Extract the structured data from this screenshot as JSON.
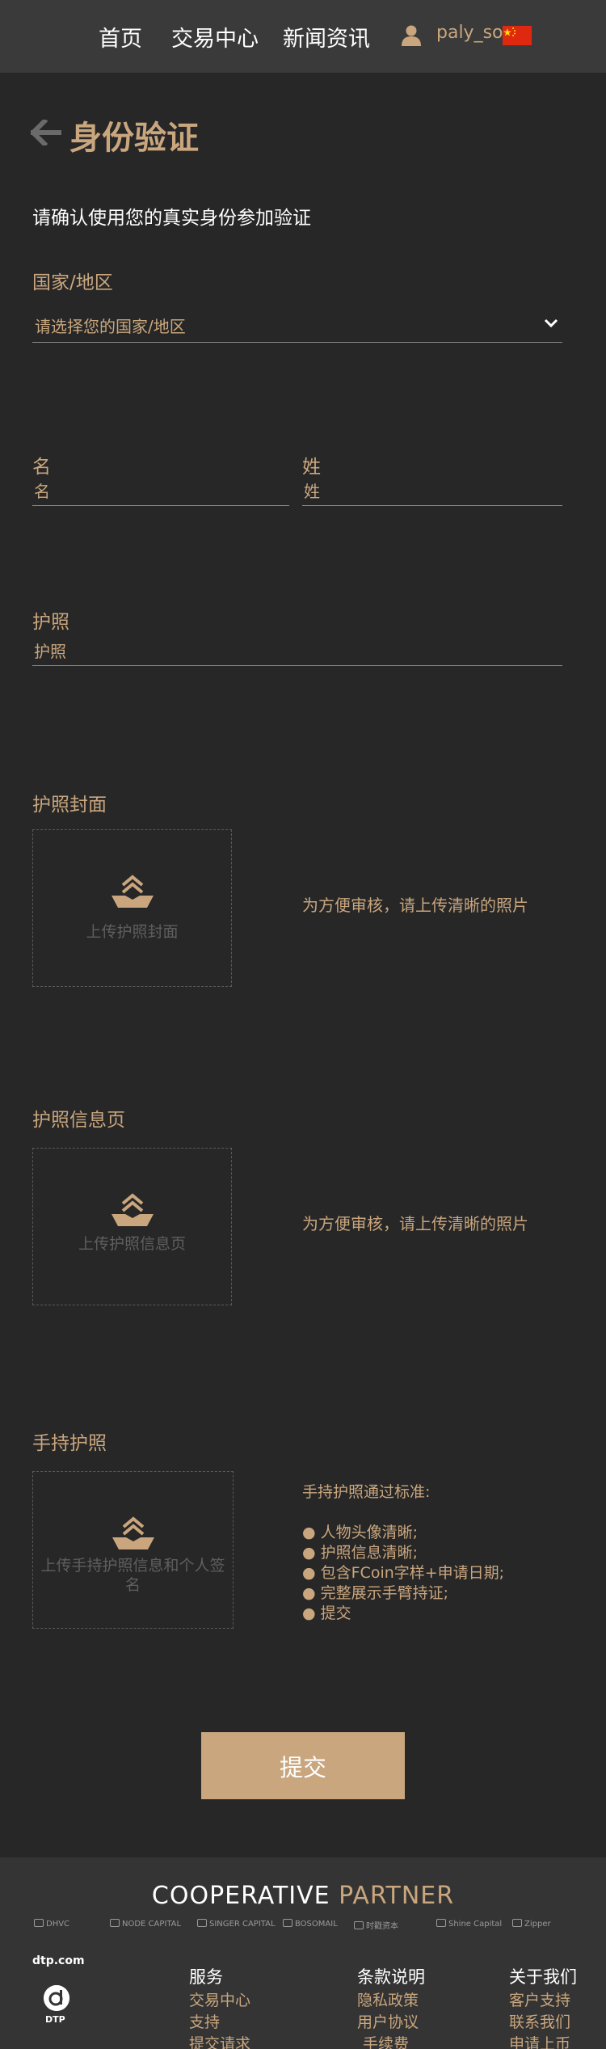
{
  "header": {
    "nav": [
      "首页",
      "交易中心",
      "新闻资讯"
    ],
    "username": "paly_so",
    "language_flag": "china-flag-icon"
  },
  "page": {
    "title": "身份验证",
    "intro": "请确认使用您的真实身份参加验证"
  },
  "form": {
    "country": {
      "label": "国家/地区",
      "placeholder": "请选择您的国家/地区"
    },
    "first_name": {
      "label": "名",
      "placeholder": "名"
    },
    "last_name": {
      "label": "姓",
      "placeholder": "姓"
    },
    "passport": {
      "label": "护照",
      "placeholder": "护照"
    },
    "uploads": [
      {
        "label": "护照封面",
        "button_text": "上传护照封面",
        "hint": "为方便审核，请上传清晰的照片"
      },
      {
        "label": "护照信息页",
        "button_text": "上传护照信息页",
        "hint": "为方便审核，请上传清晰的照片"
      },
      {
        "label": "手持护照",
        "button_text": "上传手持护照信息和个人签名"
      }
    ],
    "standards": {
      "title": "手持护照通过标准:",
      "items": [
        "人物头像清晰;",
        "护照信息清晰;",
        "包含FCoin字样+申请日期;",
        "完整展示手臂持证;",
        "提交"
      ]
    },
    "submit_label": "提交"
  },
  "footer": {
    "partner_title_a": "COOPERATIVE",
    "partner_title_b": "PARTNER",
    "partners": [
      "DHVC",
      "NODE CAPITAL",
      "SINGER CAPITAL",
      "BOSOMAIL",
      "时戳资本",
      "Shine Capital",
      "Zipper"
    ],
    "site_name": "dtp.com",
    "logo_text": "DTP",
    "columns": [
      {
        "title": "服务",
        "links": [
          "交易中心",
          "支持",
          "提交请求"
        ]
      },
      {
        "title": "条款说明",
        "links": [
          "隐私政策",
          "用户协议",
          "手续费"
        ]
      },
      {
        "title": "关于我们",
        "links": [
          "客户支持",
          "联系我们",
          "申请上币"
        ]
      }
    ]
  },
  "colors": {
    "accent": "#c9a67e",
    "background": "#272727",
    "header": "#3a3a3a",
    "footer": "#343434"
  }
}
